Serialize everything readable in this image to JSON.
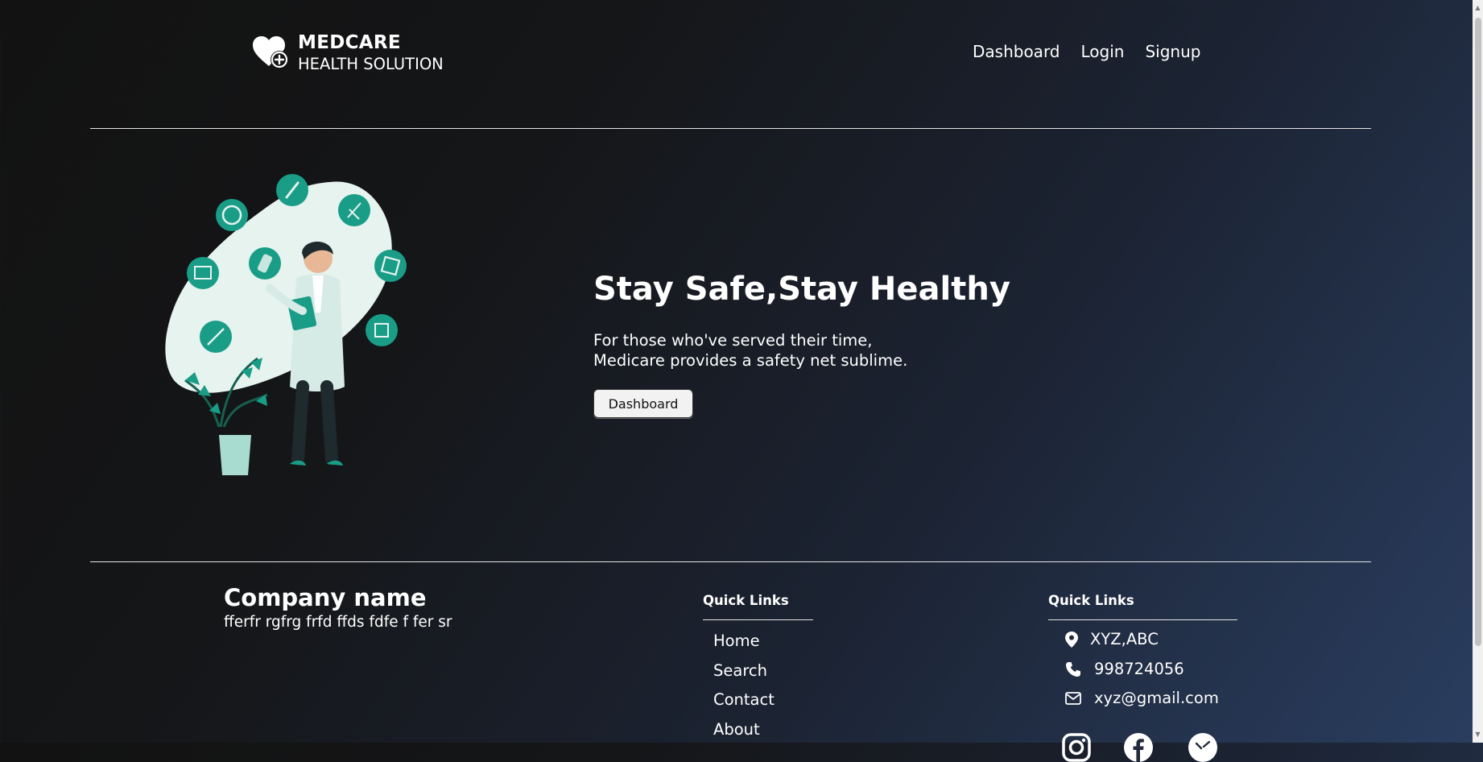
{
  "header": {
    "brand_name": "MEDCARE",
    "brand_sub": "HEALTH SOLUTION",
    "nav": [
      "Dashboard",
      "Login",
      "Signup"
    ]
  },
  "hero": {
    "title": "Stay Safe,Stay Healthy",
    "text_line1": "For those who've served their time,",
    "text_line2": "Medicare provides a safety net sublime.",
    "button_label": "Dashboard"
  },
  "footer": {
    "company_name": "Company name",
    "company_desc": "fferfr rgfrg frfd ffds fdfe f fer sr",
    "quick_links_heading": "Quick Links",
    "quick_links": [
      "Home",
      "Search",
      "Contact",
      "About"
    ],
    "contact_heading": "Quick Links",
    "contact": {
      "address": "XYZ,ABC",
      "phone": "998724056",
      "email": "xyz@gmail.com"
    },
    "social_icons": [
      "instagram-icon",
      "facebook-icon",
      "twitter-icon"
    ]
  },
  "colors": {
    "accent_teal": "#1a9d87",
    "blob": "#e8f4f1",
    "background_dark": "#121212",
    "background_blue": "#2a3e60"
  }
}
